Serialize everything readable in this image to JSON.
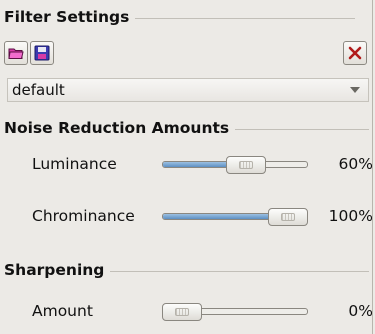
{
  "filter_settings": {
    "title": "Filter Settings",
    "preset": "default",
    "icons": {
      "open": "folder-open-icon",
      "save": "floppy-disk-icon",
      "reset": "close-icon"
    }
  },
  "noise_reduction": {
    "title": "Noise Reduction Amounts",
    "luminance": {
      "label": "Luminance",
      "value_text": "60%",
      "value": 60
    },
    "chrominance": {
      "label": "Chrominance",
      "value_text": "100%",
      "value": 100
    }
  },
  "sharpening": {
    "title": "Sharpening",
    "amount": {
      "label": "Amount",
      "value_text": "0%",
      "value": 0
    }
  },
  "colors": {
    "accent": "#5d8fc3",
    "reset_x": "#b11a1a",
    "folder": "#d63aa6",
    "disk": "#2a2a8a"
  }
}
